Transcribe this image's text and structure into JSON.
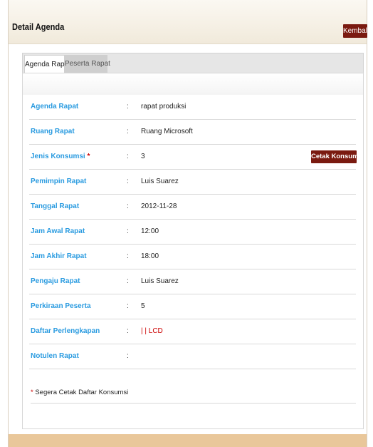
{
  "header": {
    "title": "Detail Agenda",
    "back_button": "Kembali"
  },
  "tabs": [
    {
      "label": "Agenda Rapat",
      "active": true
    },
    {
      "label": "Peserta Rapat",
      "active": false
    }
  ],
  "fields": [
    {
      "label": "Agenda Rapat",
      "value": "rapat produksi"
    },
    {
      "label": "Ruang Rapat",
      "value": "Ruang Microsoft"
    },
    {
      "label": "Jenis Konsumsi",
      "required_mark": "*",
      "value": "3",
      "action": "Cetak Konsumsi"
    },
    {
      "label": "Pemimpin Rapat",
      "value": "Luis Suarez"
    },
    {
      "label": "Tanggal Rapat",
      "value": "2012-11-28"
    },
    {
      "label": "Jam Awal Rapat",
      "value": "12:00"
    },
    {
      "label": "Jam Akhir Rapat",
      "value": "18:00"
    },
    {
      "label": "Pengaju Rapat",
      "value": "Luis Suarez"
    },
    {
      "label": "Perkiraan Peserta",
      "value": "5"
    },
    {
      "label": "Daftar Perlengkapan",
      "value": "| | LCD"
    },
    {
      "label": "Notulen Rapat",
      "value": ""
    }
  ],
  "separator": ":",
  "footnote": {
    "mark": "*",
    "text": "Segera Cetak Daftar Konsumsi"
  },
  "colors": {
    "label_blue": "#2a9be0",
    "button_maroon": "#7a1a10",
    "required_red": "#cc0000",
    "bottom_bar": "#e9c79a"
  }
}
